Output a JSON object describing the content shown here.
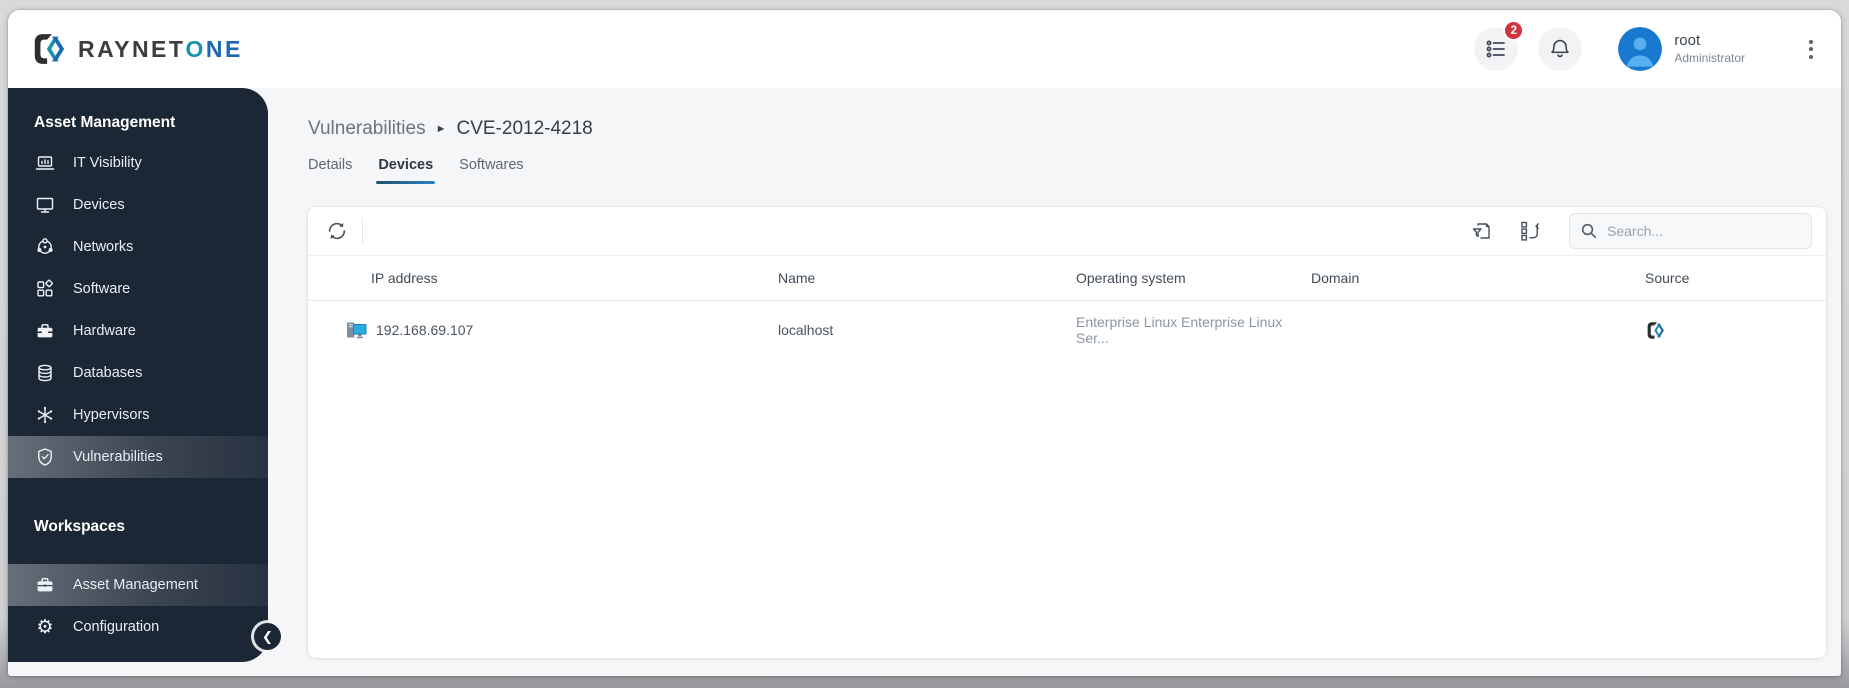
{
  "header": {
    "logo": {
      "text_dark": "RAYNET",
      "text_teal": "O",
      "text_blue": "NE"
    },
    "tasks_badge": "2",
    "user": {
      "name": "root",
      "role": "Administrator"
    }
  },
  "sidebar": {
    "section_title": "Asset Management",
    "items": [
      {
        "label": "IT Visibility",
        "icon": "laptop-icon"
      },
      {
        "label": "Devices",
        "icon": "monitor-icon"
      },
      {
        "label": "Networks",
        "icon": "network-icon"
      },
      {
        "label": "Software",
        "icon": "software-icon"
      },
      {
        "label": "Hardware",
        "icon": "toolbox-icon"
      },
      {
        "label": "Databases",
        "icon": "database-icon"
      },
      {
        "label": "Hypervisors",
        "icon": "hypervisor-icon"
      },
      {
        "label": "Vulnerabilities",
        "icon": "shield-check-icon",
        "selected": true
      }
    ],
    "workspaces_title": "Workspaces",
    "workspaces": [
      {
        "label": "Asset Management",
        "icon": "briefcase-icon",
        "selected": true
      },
      {
        "label": "Configuration",
        "icon": "gear-icon"
      }
    ]
  },
  "main": {
    "breadcrumb": {
      "parent": "Vulnerabilities",
      "separator": "►",
      "current": "CVE-2012-4218"
    },
    "tabs": [
      {
        "label": "Details"
      },
      {
        "label": "Devices",
        "active": true
      },
      {
        "label": "Softwares"
      }
    ],
    "toolbar": {
      "search_placeholder": "Search..."
    },
    "table": {
      "columns": [
        "IP address",
        "Name",
        "Operating system",
        "Domain",
        "Source"
      ],
      "rows": [
        {
          "ip": "192.168.69.107",
          "name": "localhost",
          "operating_system": "Enterprise Linux Enterprise Linux Ser...",
          "domain": "",
          "source_icon": "raynet-logo"
        }
      ]
    }
  },
  "colors": {
    "sidebar_bg": "#1c2736",
    "accent_blue": "#2b83c2",
    "logo_teal": "#1793ab",
    "logo_blue": "#1b67b3",
    "badge_red": "#d0343c",
    "avatar_blue": "#1979d0"
  }
}
